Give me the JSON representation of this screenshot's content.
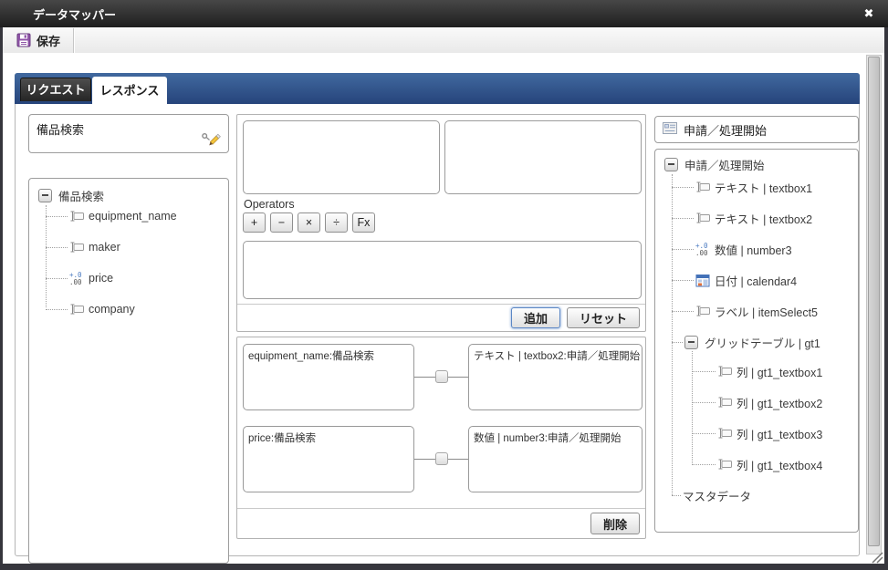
{
  "window": {
    "title": "データマッパー",
    "close_glyph": "✖"
  },
  "toolbar": {
    "save_label": "保存"
  },
  "tabs": {
    "request": "リクエスト",
    "response": "レスポンス"
  },
  "source_panel": {
    "title": "備品検索",
    "tree_root": "備品検索",
    "items": [
      {
        "type": "text",
        "label": "equipment_name"
      },
      {
        "type": "text",
        "label": "maker"
      },
      {
        "type": "number",
        "label": "price"
      },
      {
        "type": "text",
        "label": "company"
      }
    ]
  },
  "expression_panel": {
    "operators_label": "Operators",
    "operators": [
      "+",
      "−",
      "×",
      "÷",
      "Fx"
    ],
    "add_button": "追加",
    "reset_button": "リセット"
  },
  "mapping_panel": {
    "rows": [
      {
        "source": "equipment_name:備品検索",
        "target": "テキスト | textbox2:申請／処理開始"
      },
      {
        "source": "price:備品検索",
        "target": "数値 | number3:申請／処理開始"
      }
    ],
    "delete_button": "削除"
  },
  "target_panel": {
    "header": "申請／処理開始",
    "tree_root": "申請／処理開始",
    "items": [
      {
        "type": "text",
        "label": "テキスト | textbox1"
      },
      {
        "type": "text",
        "label": "テキスト | textbox2"
      },
      {
        "type": "number",
        "label": "数値 | number3"
      },
      {
        "type": "calendar",
        "label": "日付 | calendar4"
      },
      {
        "type": "text",
        "label": "ラベル | itemSelect5"
      }
    ],
    "grid_group": {
      "label": "グリッドテーブル | gt1",
      "children": [
        "列 | gt1_textbox1",
        "列 | gt1_textbox2",
        "列 | gt1_textbox3",
        "列 | gt1_textbox4"
      ]
    },
    "master_item": "マスタデータ"
  },
  "colors": {
    "accent_blue": "#2c4d86",
    "titlebar_dark": "#2b2b2b",
    "save_purple": "#9055a8"
  }
}
